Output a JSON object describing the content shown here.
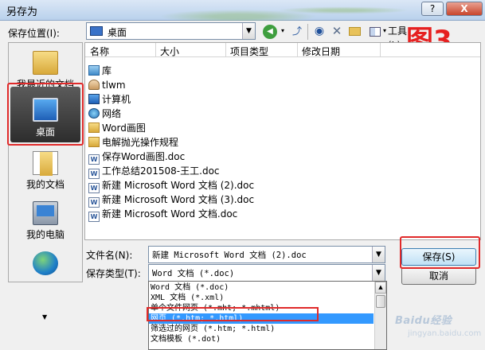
{
  "window": {
    "title": "另存为",
    "help_label": "?",
    "close_label": "X"
  },
  "location": {
    "label": "保存位置(I):",
    "value": "桌面"
  },
  "toolbar": {
    "tools_label": "工具(L)"
  },
  "annotation": {
    "text": "图3"
  },
  "places": [
    {
      "label": "我最近的文档",
      "icon": "recent-folder-icon"
    },
    {
      "label": "桌面",
      "icon": "desktop-icon",
      "selected": true
    },
    {
      "label": "我的文档",
      "icon": "my-documents-icon"
    },
    {
      "label": "我的电脑",
      "icon": "my-computer-icon"
    },
    {
      "label": "",
      "icon": "network-globe-icon"
    }
  ],
  "file_list": {
    "columns": [
      "名称",
      "大小",
      "项目类型",
      "修改日期"
    ],
    "items": [
      {
        "name": "库",
        "icon": "library-icon"
      },
      {
        "name": "tlwm",
        "icon": "user-folder-icon"
      },
      {
        "name": "计算机",
        "icon": "computer-icon"
      },
      {
        "name": "网络",
        "icon": "network-icon"
      },
      {
        "name": "Word画图",
        "icon": "folder-icon"
      },
      {
        "name": "电解抛光操作规程",
        "icon": "folder-icon"
      },
      {
        "name": "保存Word画图.doc",
        "icon": "word-doc-icon"
      },
      {
        "name": "工作总结201508-王工.doc",
        "icon": "word-doc-icon"
      },
      {
        "name": "新建 Microsoft Word 文档 (2).doc",
        "icon": "word-doc-icon"
      },
      {
        "name": "新建 Microsoft Word 文档 (3).doc",
        "icon": "word-doc-icon"
      },
      {
        "name": "新建 Microsoft Word 文档.doc",
        "icon": "word-doc-icon"
      }
    ]
  },
  "filename": {
    "label": "文件名(N):",
    "value": "新建 Microsoft Word 文档 (2).doc"
  },
  "filetype": {
    "label": "保存类型(T):",
    "value": "Word 文档 (*.doc)",
    "options": [
      "Word 文档 (*.doc)",
      "XML 文档 (*.xml)",
      "单个文件网页 (*.mht; *.mhtml)",
      "网页 (*.htm; *.html)",
      "筛选过的网页 (*.htm; *.html)",
      "文档模板 (*.dot)"
    ],
    "selected_option": "网页 (*.htm; *.html)"
  },
  "buttons": {
    "save_label": "保存(S)",
    "cancel_label": "取消"
  },
  "watermark": {
    "text": "Baidu经验",
    "sub": "jingyan.baidu.com"
  },
  "colors": {
    "accent_highlight": "#e02a2a",
    "selection_blue": "#3399ff"
  }
}
